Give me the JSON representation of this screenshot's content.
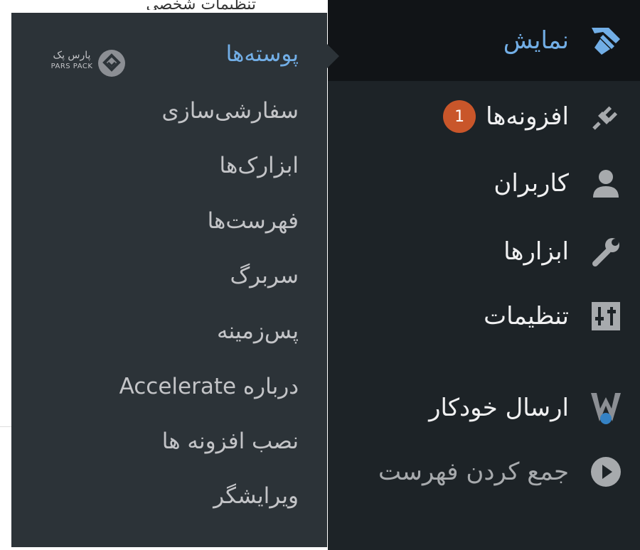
{
  "page": {
    "partial_text": "تنظیمات شخصی"
  },
  "admin_menu": {
    "items": [
      {
        "label": "نمایش",
        "icon": "paintbrush-icon",
        "state": "current"
      },
      {
        "label": "افزونه‌ها",
        "icon": "plugin-icon",
        "badge": "1"
      },
      {
        "label": "کاربران",
        "icon": "user-icon"
      },
      {
        "label": "ابزارها",
        "icon": "wrench-icon"
      },
      {
        "label": "تنظیمات",
        "icon": "sliders-icon"
      },
      {
        "label": "ارسال خودکار",
        "icon": "auto-post-icon"
      },
      {
        "label": "جمع کردن فهرست",
        "icon": "collapse-icon",
        "state": "dim"
      }
    ]
  },
  "submenu": {
    "items": [
      {
        "label": "پوسته‌ها",
        "state": "current"
      },
      {
        "label": "سفارشی‌سازی"
      },
      {
        "label": "ابزارک‌ها"
      },
      {
        "label": "فهرست‌ها"
      },
      {
        "label": "سربرگ"
      },
      {
        "label": "پس‌زمینه"
      },
      {
        "label": "درباره Accelerate"
      },
      {
        "label": "نصب افزونه ها"
      },
      {
        "label": "ویرایشگر"
      }
    ]
  },
  "watermark": {
    "name_fa": "پارس پک",
    "name_en": "PARS PACK"
  },
  "colors": {
    "menu_bg": "#1d2327",
    "current_bg": "#111417",
    "submenu_bg": "#2c3338",
    "accent": "#72aee6",
    "badge": "#c9562a"
  }
}
